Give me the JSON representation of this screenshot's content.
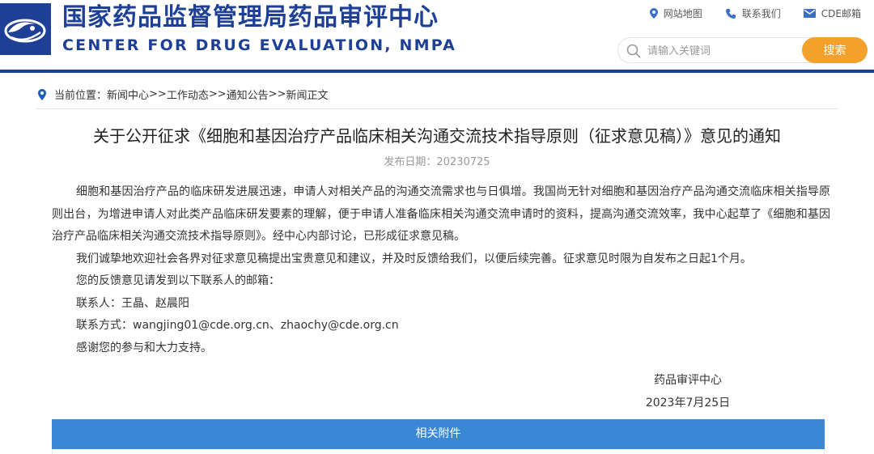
{
  "header": {
    "title_cn": "国家药品监督管理局药品审评中心",
    "title_en": "CENTER FOR DRUG EVALUATION, NMPA",
    "links": [
      {
        "label": "网站地图",
        "icon": "map-pin-icon"
      },
      {
        "label": "联系我们",
        "icon": "phone-icon"
      },
      {
        "label": "CDE邮箱",
        "icon": "mail-icon"
      }
    ],
    "search": {
      "placeholder": "请输入关键词",
      "button_label": "搜索"
    }
  },
  "breadcrumb": {
    "prefix": "当前位置：",
    "items": [
      "新闻中心",
      "工作动态",
      "通知公告",
      "新闻正文"
    ],
    "separator": ">>"
  },
  "article": {
    "title": "关于公开征求《细胞和基因治疗产品临床相关沟通交流技术指导原则（征求意见稿）》意见的通知",
    "date": "发布日期：20230725",
    "paragraphs": [
      "细胞和基因治疗产品的临床研发进展迅速，申请人对相关产品的沟通交流需求也与日俱增。我国尚无针对细胞和基因治疗产品沟通交流临床相关指导原则出台，为增进申请人对此类产品临床研发要素的理解，便于申请人准备临床相关沟通交流申请时的资料，提高沟通交流效率，我中心起草了《细胞和基因治疗产品临床相关沟通交流技术指导原则》。经中心内部讨论，已形成征求意见稿。",
      "我们诚挚地欢迎社会各界对征求意见稿提出宝贵意见和建议，并及时反馈给我们，以便后续完善。征求意见时限为自发布之日起1个月。"
    ],
    "lines": [
      "您的反馈意见请发到以下联系人的邮箱：",
      "联系人：王晶、赵晨阳",
      "联系方式：wangjing01@cde.org.cn、zhaochy@cde.org.cn",
      "感谢您的参与和大力支持。"
    ],
    "signature": {
      "org": "药品审评中心",
      "date": "2023年7月25日"
    }
  },
  "attachments": {
    "label": "相关附件"
  },
  "colors": {
    "brand": "#1d3f95",
    "accent": "#f3a12b",
    "attach_bar": "#3a87d6"
  }
}
